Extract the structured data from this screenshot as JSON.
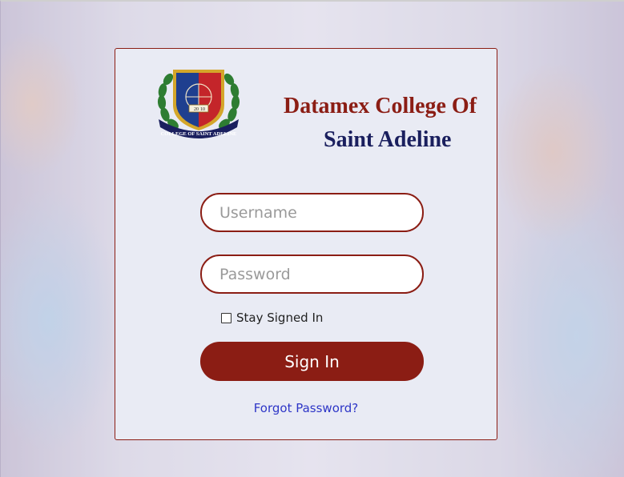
{
  "brand": {
    "title_line1": "Datamex College Of",
    "title_line2": "Saint Adeline",
    "seal": {
      "year_left": "20",
      "year_right": "10",
      "ribbon_text": "COLLEGE OF SAINT ADELINE"
    },
    "colors": {
      "maroon": "#8b1d14",
      "navy": "#1a1f5e",
      "seal_blue": "#1f3f8f",
      "seal_red": "#c4252a",
      "laurel_green": "#2e7d32",
      "gold": "#d4a62a"
    }
  },
  "form": {
    "username_placeholder": "Username",
    "username_value": "",
    "password_placeholder": "Password",
    "password_value": "",
    "remember_label": "Stay Signed In",
    "remember_checked": false,
    "signin_label": "Sign In",
    "forgot_label": "Forgot Password?"
  }
}
